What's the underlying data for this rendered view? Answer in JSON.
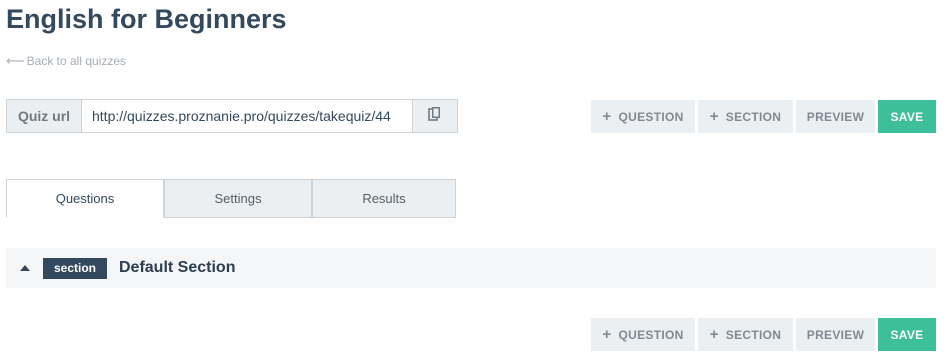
{
  "page": {
    "title": "English for Beginners",
    "back_link": "Back to all quizzes"
  },
  "quiz_url": {
    "label": "Quiz url",
    "value": "http://quizzes.proznanie.pro/quizzes/takequiz/44"
  },
  "toolbar": {
    "question_label": "QUESTION",
    "section_label": "SECTION",
    "preview_label": "PREVIEW",
    "save_label": "SAVE"
  },
  "tabs": [
    {
      "label": "Questions",
      "active": true
    },
    {
      "label": "Settings",
      "active": false
    },
    {
      "label": "Results",
      "active": false
    }
  ],
  "section": {
    "badge": "section",
    "name": "Default Section"
  },
  "colors": {
    "primary_text": "#34495e",
    "save_accent": "#3dbf9c",
    "button_bg": "#eceff1"
  },
  "icons": {
    "back": "arrow-left-icon",
    "copy": "copy-icon",
    "add": "plus-icon",
    "collapse": "caret-up-icon"
  }
}
